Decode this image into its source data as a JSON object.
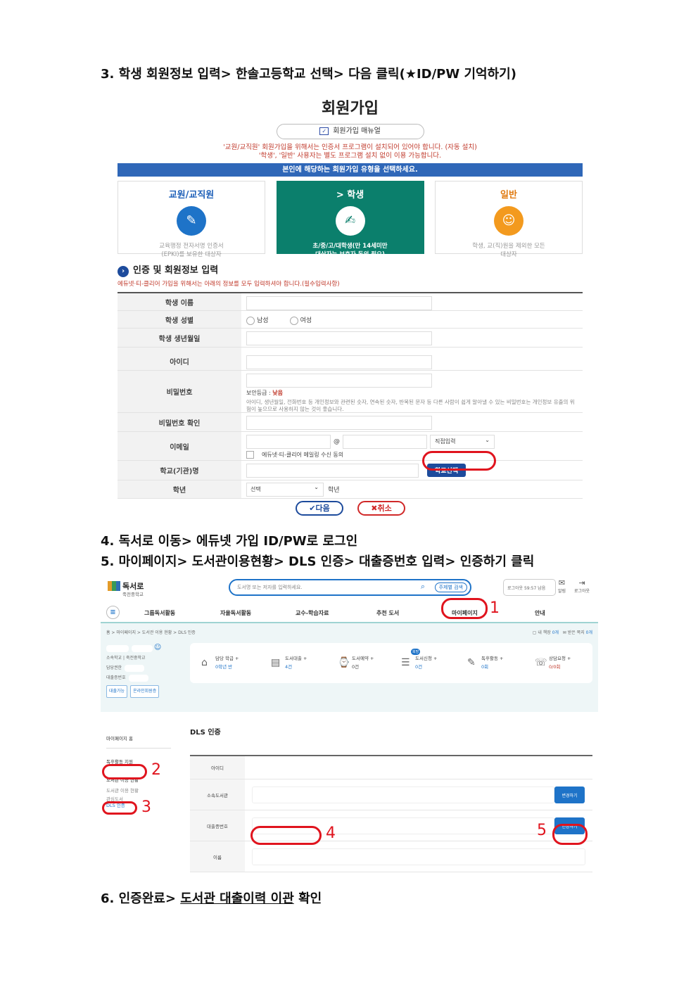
{
  "steps": {
    "s3": "3. 학생 회원정보 입력> 한솔고등학교 선택> 다음 클릭(★ID/PW 기억하기)",
    "s4": "4. 독서로 이동> 에듀넷 가입 ID/PW로 로그인",
    "s5": "5. 마이페이지> 도서관이용현황> DLS 인증> 대출증번호 입력> 인증하기 클릭",
    "s6_prefix": "6. 인증완료> ",
    "s6_underlined": "도서관 대출이력 이관",
    "s6_suffix": " 확인"
  },
  "signup": {
    "title": "회원가입",
    "manual_button": "회원가입 매뉴얼",
    "notice_line1": "'교원/교직원' 회원가입을 위해서는 인증서 프로그램이 설치되어 있어야 합니다. (자동 설치)",
    "notice_line2": "'학생', '일반' 사용자는 별도 프로그램 설치 없이 이용 가능합니다.",
    "select_bar": "본인에 해당하는 회원가입 유형을 선택하세요.",
    "types": [
      {
        "name": "교원/교직원",
        "desc1": "교육행정 전자서명 인증서",
        "desc2": "(EPKI)를 보유한 대상자",
        "icon": "teacher-icon"
      },
      {
        "name": "> 학생",
        "desc1": "초/중/고/대학생(만 14세미만",
        "desc2": "대상자는 보호자 동의 필요)",
        "icon": "student-icon"
      },
      {
        "name": "일반",
        "desc1": "학생, 교(직)원을 제외한 모든",
        "desc2": "대상자",
        "icon": "general-icon"
      }
    ],
    "section_title": "인증 및 회원정보 입력",
    "section_note": "에듀넷·티-클리어 가입을 위해서는 아래의 정보를 모두 입력하셔야 합니다.(필수입력사항)",
    "fields": {
      "student_name": "학생 이름",
      "student_gender": "학생 성별",
      "male": "남성",
      "female": "여성",
      "student_birth": "학생 생년월일",
      "id": "아이디",
      "password": "비밀번호",
      "security_level_label": "보안등급 : ",
      "security_level_value": "낮음",
      "pw_note": "아이디, 생년월일, 전화번호 등 개인정보와 관련된 숫자, 연속된 숫자, 반복된 문자 등 다른 사람이 쉽게 알아낼 수 있는 비밀번호는 개인정보 유출의 위험이 높으므로 사용하지 않는 것이 좋습니다.",
      "password_confirm": "비밀번호 확인",
      "email": "이메일",
      "email_at": "@",
      "email_domain_select": "직접입력",
      "email_consent": "에듀넷·티-클리어 메일링 수신 동의",
      "school": "학교(기관)명",
      "school_button": "학교선택",
      "grade": "학년",
      "grade_select": "선택",
      "grade_suffix": "학년"
    },
    "next_button": "다음",
    "cancel_button": "취소"
  },
  "library": {
    "logo_name": "독서로",
    "logo_sub": "죽전중학교",
    "search_placeholder": "도서명 또는 저자를 입력하세요.",
    "search_option": "주제별 검색",
    "logout_timer": "로그아웃 59:57 남음",
    "alerts_label": "알림",
    "logout_label": "로그아웃",
    "nav": [
      "그룹독서활동",
      "자율독서활동",
      "교수-학습자료",
      "추천 도서",
      "마이페이지",
      "안내"
    ],
    "breadcrumb": "홈 > 마이페이지 > 도서관 이용 현황 > DLS 인증",
    "my_books": "내 책장",
    "my_books_count": "0개",
    "received_notes": "받은 쪽지",
    "received_notes_count": "0개",
    "profile": {
      "school_label": "소속학교",
      "school_value": "죽전중학교",
      "teacher_label": "담당권한",
      "card_label": "대출증번호",
      "tag1": "대출가능",
      "tag2": "온라인회원증"
    },
    "stats": [
      {
        "label": "담당 학급 +",
        "value": "0학년 반",
        "icon": "classroom-icon"
      },
      {
        "label": "도서대출 +",
        "value": "4건",
        "icon": "book-loan-icon"
      },
      {
        "label": "도서예약 +",
        "value": "0건",
        "icon": "reservation-icon"
      },
      {
        "label": "도서신청 +",
        "value": "0건",
        "icon": "book-request-icon",
        "badge": "희망"
      },
      {
        "label": "독후활동 +",
        "value": "0회",
        "icon": "reading-activity-icon"
      },
      {
        "label": "상담요청 +",
        "value": "0/0회",
        "icon": "counsel-icon"
      }
    ],
    "side_menu": [
      "마이페이지 홈",
      "독후활동 지원",
      "도서관 이용 현황",
      "도서관 이용 현황",
      "관심도서",
      "DLS 인증"
    ],
    "panel_title": "DLS 인증",
    "rows": {
      "id": "아이디",
      "library": "소속도서관",
      "change_button": "변경하기",
      "card_no": "대출증번호",
      "verify_button": "인증하기",
      "name": "이름"
    },
    "annotations": [
      "1",
      "2",
      "3",
      "4",
      "5"
    ]
  },
  "colors": {
    "highlight": "#e0141e",
    "primary": "#1e73c8",
    "student_green": "#0b7f6c"
  }
}
